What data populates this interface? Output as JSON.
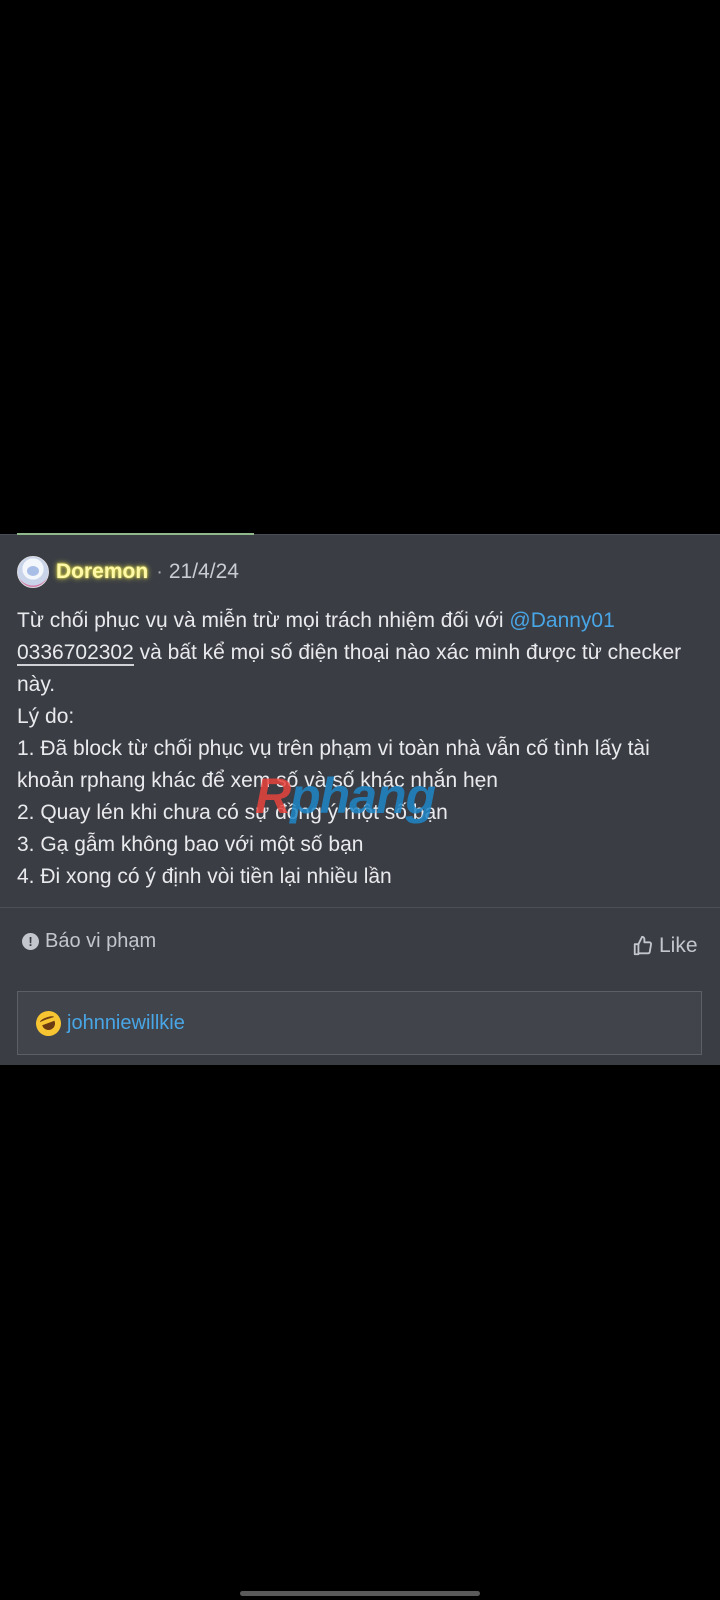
{
  "post": {
    "username": "Doremon",
    "separator": "·",
    "date": "21/4/24",
    "line1_text": "Từ chối phục vụ và miễn trừ mọi trách nhiệm đối với ",
    "mention": "@Danny01",
    "phone": "0336702302",
    "line2_text": " và bất kể mọi số điện thoại nào xác minh được từ checker này.",
    "reason_label": "Lý do:",
    "reasons": [
      "1. Đã block từ chối phục vụ trên phạm vi toàn nhà vẫn cố tình lấy tài khoản rphang khác để xem số và số khác nhắn hẹn",
      "2. Quay lén khi chưa có sự đồng ý một số bạn",
      "3. Gạ gẫm không bao với một số bạn",
      "4. Đi xong có ý định vòi tiền lại nhiều lần"
    ],
    "watermark": {
      "first": "R",
      "rest": "phang"
    },
    "report_label": "Báo vi phạm",
    "report_icon_glyph": "!",
    "like_label": "Like",
    "reaction_user": "johnniewillkie"
  },
  "colors": {
    "background": "#000000",
    "card": "#3a3d44",
    "username_glow": "#e5e04a",
    "link": "#49a6e6"
  },
  "icons": [
    "avatar",
    "exclamation-circle-icon",
    "thumbs-up-icon",
    "laughing-emoji-icon"
  ]
}
